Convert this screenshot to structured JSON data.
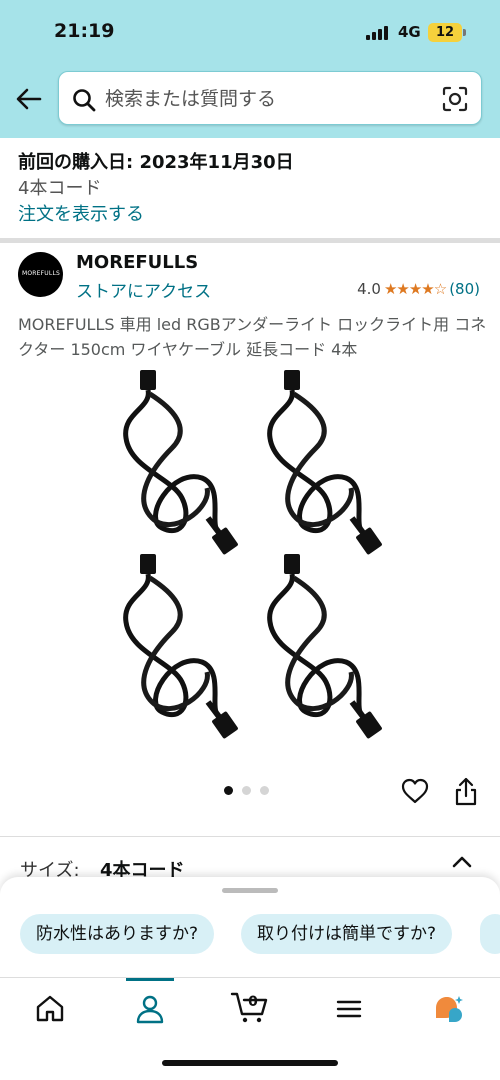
{
  "status": {
    "time": "21:19",
    "network": "4G",
    "battery": "12"
  },
  "search": {
    "placeholder": "検索または質問する"
  },
  "order": {
    "purchase_date": "前回の購入日: 2023年11月30日",
    "variant": "4本コード",
    "view_order": "注文を表示する"
  },
  "brand": {
    "logo_text": "MOREFULLS",
    "name": "MOREFULLS",
    "store_link": "ストアにアクセス",
    "rating": "4.0",
    "stars": "★★★★☆",
    "review_count": "(80)"
  },
  "product": {
    "title": "MOREFULLS 車用 led RGBアンダーライト ロックライト用 コネクター 150cm ワイヤケーブル 延長コード 4本",
    "image_pages": 3,
    "current_page": 1
  },
  "size": {
    "label": "サイズ:",
    "value": "4本コード"
  },
  "suggestions": [
    "防水性はありますか?",
    "取り付けは簡単ですか?"
  ],
  "tabs": [
    "home",
    "account",
    "cart",
    "menu",
    "rufus"
  ],
  "cart_count": "0",
  "colors": {
    "header_bg": "#a6e3e9",
    "link": "#007185",
    "star": "#de7921",
    "chip_bg": "#d8f0f6"
  }
}
